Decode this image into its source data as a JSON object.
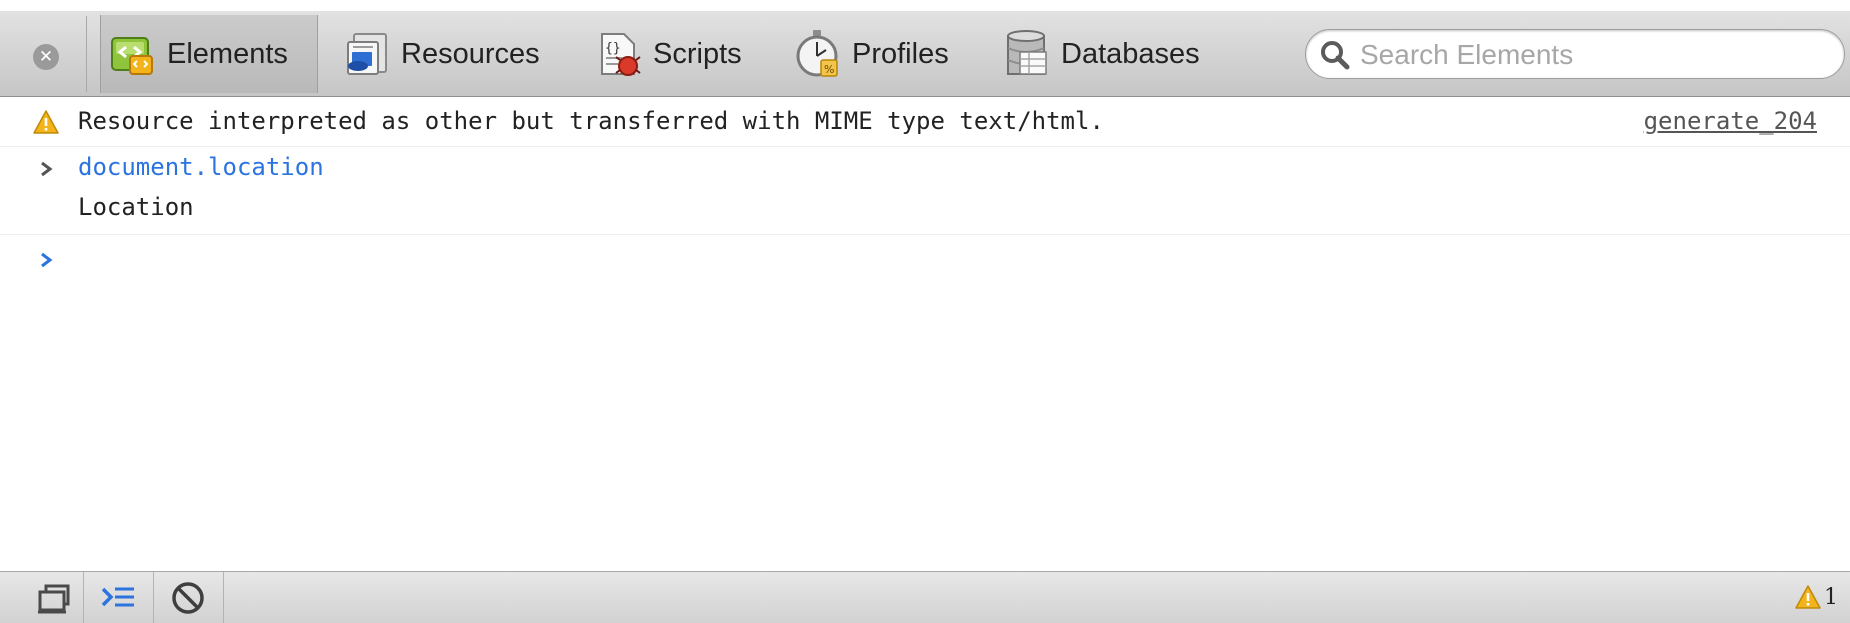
{
  "toolbar": {
    "tabs": [
      {
        "label": "Elements",
        "icon": "elements-icon",
        "selected": true
      },
      {
        "label": "Resources",
        "icon": "resources-icon",
        "selected": false
      },
      {
        "label": "Scripts",
        "icon": "scripts-icon",
        "selected": false
      },
      {
        "label": "Profiles",
        "icon": "profiles-icon",
        "selected": false
      },
      {
        "label": "Databases",
        "icon": "databases-icon",
        "selected": false
      }
    ],
    "search": {
      "placeholder": "Search Elements",
      "value": ""
    }
  },
  "console": {
    "warning": {
      "message": "Resource interpreted as other but transferred with MIME type text/html.",
      "source": "generate_204"
    },
    "command": "document.location",
    "result": "Location"
  },
  "statusbar": {
    "warning_count": "1",
    "buttons": [
      "dock-icon",
      "console-icon",
      "clear-icon"
    ]
  },
  "colors": {
    "command_text": "#2b74e0",
    "warning_yellow": "#f2b31b",
    "toolbar_top": "#e2e2e2",
    "toolbar_bottom": "#c6c6c6"
  }
}
